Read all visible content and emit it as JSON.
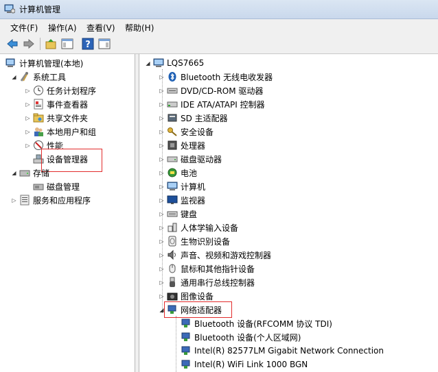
{
  "window": {
    "title": "计算机管理"
  },
  "menu": [
    "文件(F)",
    "操作(A)",
    "查看(V)",
    "帮助(H)"
  ],
  "toolbar": [
    "back-icon",
    "forward-icon",
    "up-folder-icon",
    "console-tree-icon",
    "help-icon",
    "properties-pane-icon"
  ],
  "left_tree": {
    "root": "计算机管理(本地)",
    "system_tools": "系统工具",
    "task_scheduler": "任务计划程序",
    "event_viewer": "事件查看器",
    "shared_folders": "共享文件夹",
    "local_users": "本地用户和组",
    "performance": "性能",
    "device_manager": "设备管理器",
    "storage": "存储",
    "disk_management": "磁盘管理",
    "services_apps": "服务和应用程序"
  },
  "right_tree": {
    "root": "LQS7665",
    "categories": [
      "Bluetooth 无线电收发器",
      "DVD/CD-ROM 驱动器",
      "IDE ATA/ATAPI 控制器",
      "SD 主适配器",
      "安全设备",
      "处理器",
      "磁盘驱动器",
      "电池",
      "计算机",
      "监视器",
      "键盘",
      "人体学输入设备",
      "生物识别设备",
      "声音、视频和游戏控制器",
      "鼠标和其他指针设备",
      "通用串行总线控制器",
      "图像设备",
      "网络适配器"
    ],
    "network_adapters": [
      "Bluetooth 设备(RFCOMM 协议 TDI)",
      "Bluetooth 设备(个人区域网)",
      "Intel(R) 82577LM Gigabit Network Connection",
      "Intel(R) WiFi Link 1000 BGN"
    ]
  }
}
